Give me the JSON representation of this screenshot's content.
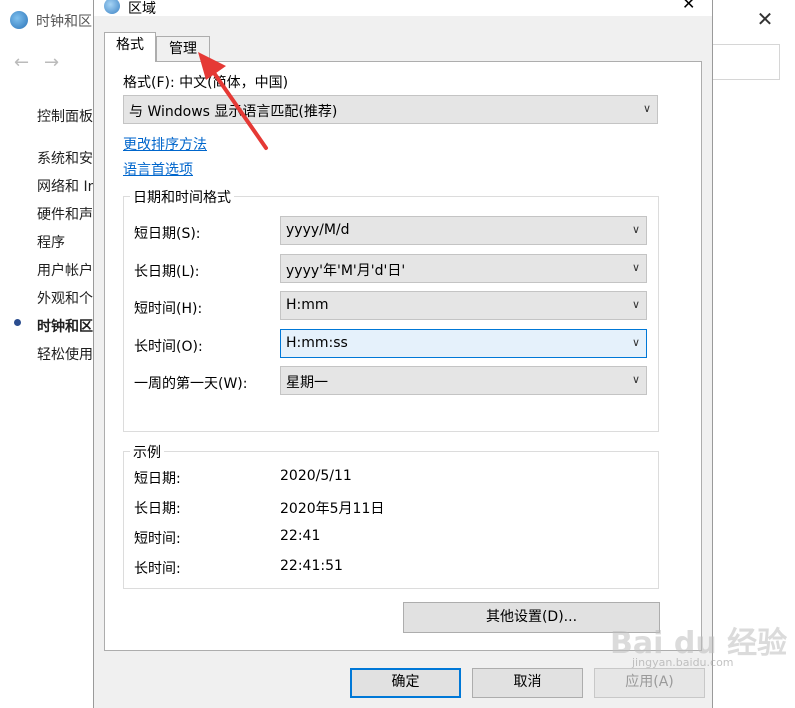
{
  "background_window": {
    "title": "时钟和区",
    "close_glyph": "✕",
    "nav_back": "←",
    "nav_forward": "→",
    "sidebar": [
      "控制面板",
      "系统和安",
      "网络和 In",
      "硬件和声",
      "程序",
      "用户帐户",
      "外观和个",
      "时钟和区",
      "轻松使用"
    ]
  },
  "dialog": {
    "title": "区域",
    "close_glyph": "✕",
    "tabs": [
      "格式",
      "管理"
    ],
    "format_label": "格式(F): 中文(简体，中国)",
    "format_value": "与 Windows 显示语言匹配(推荐)",
    "links": {
      "change_sort": "更改排序方法",
      "language_prefs": "语言首选项"
    },
    "datetime_group": {
      "title": "日期和时间格式",
      "rows": [
        {
          "label": "短日期(S):",
          "value": "yyyy/M/d"
        },
        {
          "label": "长日期(L):",
          "value": "yyyy'年'M'月'd'日'"
        },
        {
          "label": "短时间(H):",
          "value": "H:mm"
        },
        {
          "label": "长时间(O):",
          "value": "H:mm:ss"
        },
        {
          "label": "一周的第一天(W):",
          "value": "星期一"
        }
      ]
    },
    "example_group": {
      "title": "示例",
      "rows": [
        {
          "label": "短日期:",
          "value": "2020/5/11"
        },
        {
          "label": "长日期:",
          "value": "2020年5月11日"
        },
        {
          "label": "短时间:",
          "value": "22:41"
        },
        {
          "label": "长时间:",
          "value": "22:41:51"
        }
      ]
    },
    "other_settings_button": "其他设置(D)...",
    "buttons": {
      "ok": "确定",
      "cancel": "取消",
      "apply": "应用(A)"
    }
  },
  "watermark": {
    "main": "Bai du 经验",
    "sub": "jingyan.baidu.com"
  },
  "colors": {
    "link": "#0066cc",
    "annotation_arrow": "#e53935",
    "focus_border": "#0078d7"
  }
}
